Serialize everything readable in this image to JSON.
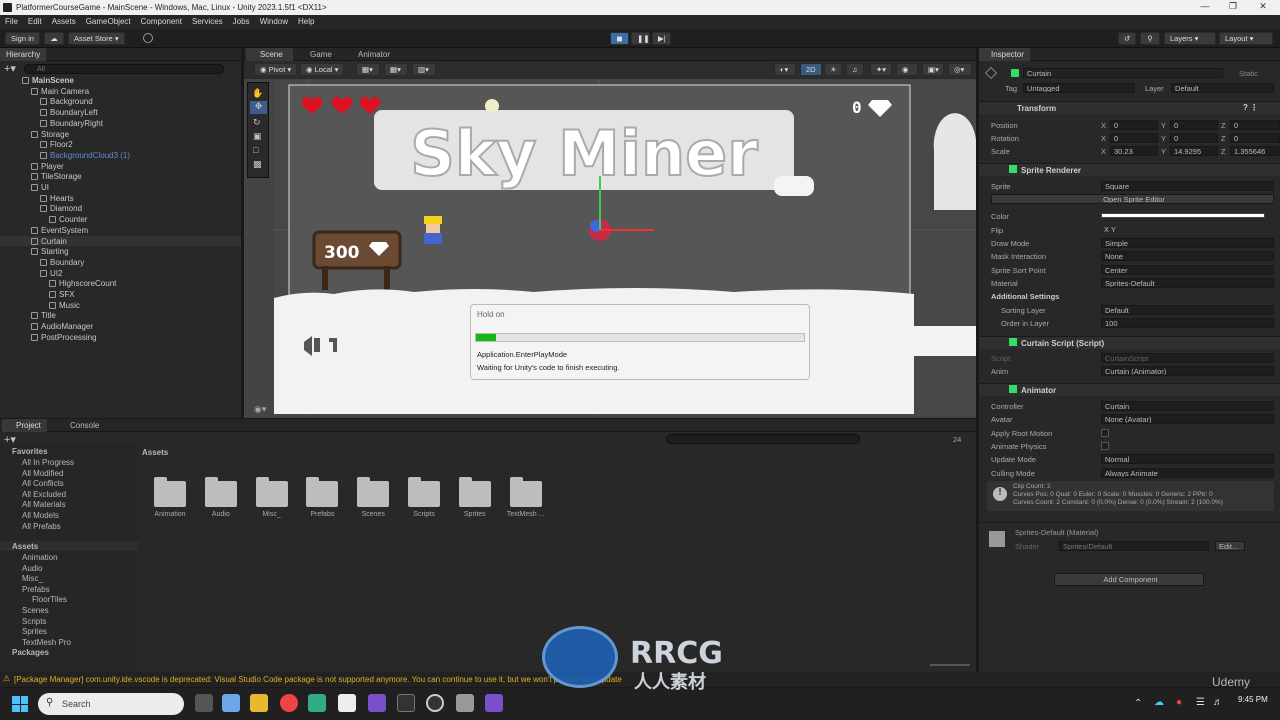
{
  "window": {
    "title": "PlatformerCourseGame - MainScene - Windows, Mac, Linux - Unity 2023.1.5f1 <DX11>"
  },
  "menu": [
    "File",
    "Edit",
    "Assets",
    "GameObject",
    "Component",
    "Services",
    "Jobs",
    "Window",
    "Help"
  ],
  "toolbar": {
    "sign_in": "Sign in",
    "asset_store": "Asset Store",
    "layers": "Layers",
    "layout": "Layout"
  },
  "hierarchy": {
    "tab": "Hierarchy",
    "search_placeholder": "All",
    "items": [
      {
        "label": "MainScene",
        "depth": 0
      },
      {
        "label": "Main Camera",
        "depth": 1
      },
      {
        "label": "Background",
        "depth": 2
      },
      {
        "label": "BoundaryLeft",
        "depth": 2
      },
      {
        "label": "BoundaryRight",
        "depth": 2
      },
      {
        "label": "Storage",
        "depth": 1
      },
      {
        "label": "Floor2",
        "depth": 2
      },
      {
        "label": "BackgroundCloud3 (1)",
        "depth": 2
      },
      {
        "label": "Player",
        "depth": 1
      },
      {
        "label": "TileStorage",
        "depth": 1
      },
      {
        "label": "UI",
        "depth": 1
      },
      {
        "label": "Hearts",
        "depth": 2
      },
      {
        "label": "Diamond",
        "depth": 2
      },
      {
        "label": "Counter",
        "depth": 3
      },
      {
        "label": "EventSystem",
        "depth": 1
      },
      {
        "label": "Curtain",
        "depth": 1
      },
      {
        "label": "Starting",
        "depth": 1
      },
      {
        "label": "Boundary",
        "depth": 2
      },
      {
        "label": "UI2",
        "depth": 2
      },
      {
        "label": "HighscoreCount",
        "depth": 3
      },
      {
        "label": "SFX",
        "depth": 3
      },
      {
        "label": "Music",
        "depth": 3
      },
      {
        "label": "Title",
        "depth": 1
      },
      {
        "label": "AudioManager",
        "depth": 1
      },
      {
        "label": "PostProcessing",
        "depth": 1
      }
    ]
  },
  "scene_tabs": [
    "Scene",
    "Game",
    "Animator"
  ],
  "scene_toolbar": {
    "pivot": "Pivot",
    "local": "Local",
    "mode_2d": "2D"
  },
  "game": {
    "title": "Sky Miner",
    "diamond_count": "0",
    "score": "300"
  },
  "dialog": {
    "title": "Hold on",
    "task": "Application.EnterPlayMode",
    "message": "Waiting for Unity's code to finish executing.",
    "progress": 0.06
  },
  "inspector": {
    "tab": "Inspector",
    "object_name": "Curtain",
    "static": "Static",
    "tag_label": "Tag",
    "tag": "Untagged",
    "layer_label": "Layer",
    "layer": "Default",
    "transform": {
      "title": "Transform",
      "position": [
        "0",
        "0",
        "0"
      ],
      "rotation": [
        "0",
        "0",
        "0"
      ],
      "scale": [
        "30.23",
        "14.9295",
        "1.355646"
      ],
      "labels": [
        "Position",
        "Rotation",
        "Scale"
      ]
    },
    "sprite_renderer": {
      "title": "Sprite Renderer",
      "rows": [
        {
          "label": "Sprite",
          "value": "Square"
        },
        {
          "label": "Color",
          "value": ""
        },
        {
          "label": "Flip",
          "value": "X   Y"
        },
        {
          "label": "Draw Mode",
          "value": "Simple"
        },
        {
          "label": "Mask Interaction",
          "value": "None"
        },
        {
          "label": "Sprite Sort Point",
          "value": "Center"
        },
        {
          "label": "Material",
          "value": "Sprites-Default"
        }
      ],
      "open_editor": "Open Sprite Editor",
      "additional": "Additional Settings",
      "sorting_layer_label": "Sorting Layer",
      "sorting_layer": "Default",
      "order_label": "Order in Layer",
      "order": "100"
    },
    "curtain_script": {
      "title": "Curtain Script (Script)",
      "script_label": "Script",
      "script": "CurtainScript",
      "anim_label": "Anim",
      "anim": "Curtain (Animator)"
    },
    "animator": {
      "title": "Animator",
      "rows": [
        {
          "label": "Controller",
          "value": "Curtain"
        },
        {
          "label": "Avatar",
          "value": "None (Avatar)"
        },
        {
          "label": "Apply Root Motion",
          "value": ""
        },
        {
          "label": "Animate Physics",
          "value": ""
        },
        {
          "label": "Update Mode",
          "value": "Normal"
        },
        {
          "label": "Culling Mode",
          "value": "Always Animate"
        }
      ],
      "info": [
        "Clip Count: 2",
        "Curves Pos: 0 Quat: 0 Euler: 0 Scale: 0 Muscles: 0 Generic: 2 PPtr: 0",
        "Curves Count: 2 Constant: 0 (0.0%) Dense: 0 (0.0%) Stream: 2 (100.0%)"
      ]
    },
    "material": {
      "name": "Sprites-Default (Material)",
      "shader_label": "Shader",
      "shader": "Sprites/Default",
      "edit": "Edit..."
    },
    "add_component": "Add Component"
  },
  "project": {
    "tabs": [
      "Project",
      "Console"
    ],
    "hidden_count": "24",
    "favorites_title": "Favorites",
    "favorites": [
      "All In Progress",
      "All Modified",
      "All Conflicts",
      "All Excluded",
      "All Materials",
      "All Models",
      "All Prefabs"
    ],
    "assets_title": "Assets",
    "tree": [
      {
        "label": "Animation",
        "depth": 1
      },
      {
        "label": "Audio",
        "depth": 1
      },
      {
        "label": "Misc_",
        "depth": 1
      },
      {
        "label": "Prefabs",
        "depth": 1
      },
      {
        "label": "FloorTiles",
        "depth": 2
      },
      {
        "label": "Scenes",
        "depth": 1
      },
      {
        "label": "Scripts",
        "depth": 1
      },
      {
        "label": "Sprites",
        "depth": 1
      },
      {
        "label": "TextMesh Pro",
        "depth": 1
      }
    ],
    "packages": "Packages",
    "breadcrumb": "Assets",
    "folders": [
      "Animation",
      "Audio",
      "Misc_",
      "Prefabs",
      "Scenes",
      "Scripts",
      "Sprites",
      "TextMesh ..."
    ]
  },
  "status": {
    "message": "[Package Manager] com.unity.ide.vscode is deprecated: Visual Studio Code package is not supported anymore. You can continue to use it, but we won't provide any update"
  },
  "taskbar": {
    "search": "Search",
    "time": "9:45 PM"
  },
  "watermark": {
    "brand": "RRCG",
    "sub": "人人素材",
    "udemy": "Udemy"
  }
}
